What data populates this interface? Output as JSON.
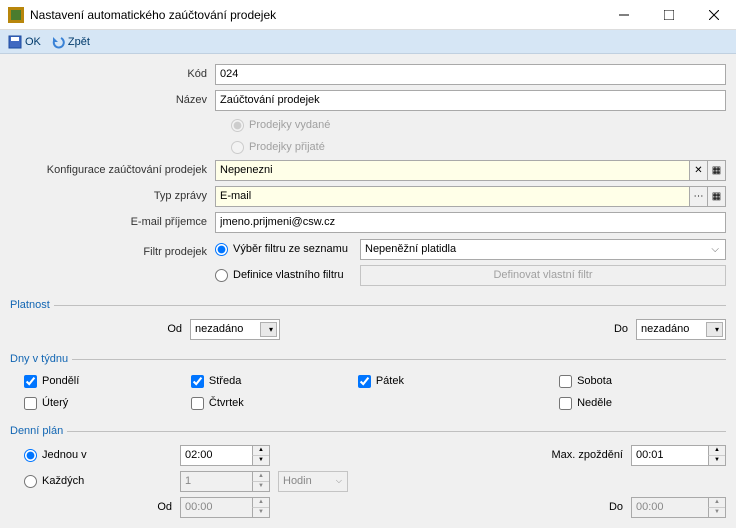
{
  "window": {
    "title": "Nastavení automatického zaúčtování prodejek"
  },
  "toolbar": {
    "ok": "OK",
    "back": "Zpět"
  },
  "fields": {
    "kod_label": "Kód",
    "kod_value": "024",
    "nazev_label": "Název",
    "nazev_value": "Zaúčtování prodejek",
    "radio_vydane": "Prodejky vydané",
    "radio_prijate": "Prodejky přijaté",
    "konfig_label": "Konfigurace zaúčtování prodejek",
    "konfig_value": "Nepenezni",
    "typ_label": "Typ zprávy",
    "typ_value": "E-mail",
    "email_label": "E-mail příjemce",
    "email_value": "jmeno.prijmeni@csw.cz",
    "filtr_label": "Filtr prodejek",
    "filtr_vyber": "Výběr filtru ze seznamu",
    "filtr_list_value": "Nepeněžní platidla",
    "filtr_def": "Definice vlastního filtru",
    "def_btn": "Definovat vlastní filtr"
  },
  "platnost": {
    "header": "Platnost",
    "od": "Od",
    "od_value": "nezadáno",
    "do": "Do",
    "do_value": "nezadáno"
  },
  "dny": {
    "header": "Dny v týdnu",
    "po": "Pondělí",
    "ut": "Úterý",
    "st": "Středa",
    "ct": "Čtvrtek",
    "pa": "Pátek",
    "so": "Sobota",
    "ne": "Neděle"
  },
  "plan": {
    "header": "Denní plán",
    "jednou": "Jednou v",
    "jednou_value": "02:00",
    "kazdych": "Každých",
    "kazdych_value": "1",
    "hodin": "Hodin",
    "max": "Max. zpoždění",
    "max_value": "00:01",
    "od": "Od",
    "od_value": "00:00",
    "do": "Do",
    "do_value": "00:00"
  }
}
